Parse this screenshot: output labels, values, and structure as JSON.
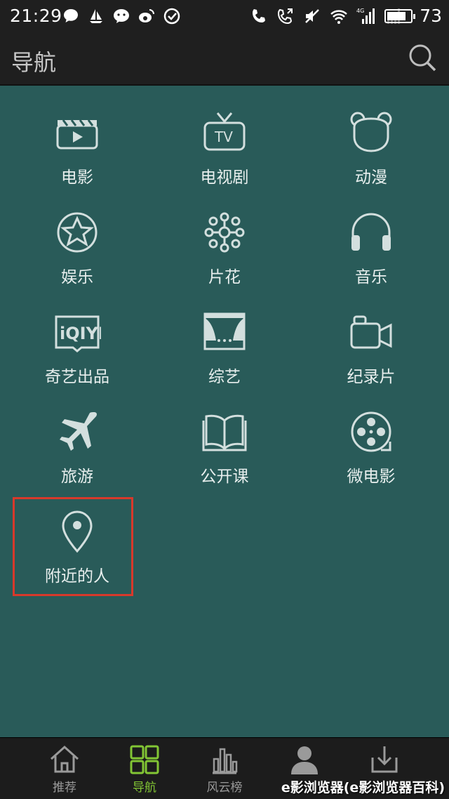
{
  "status_bar": {
    "time": "21:29",
    "battery": "73",
    "battery_level_percent": 73,
    "left_icons": [
      "chat-icon",
      "sailing-icon",
      "wechat-icon",
      "weibo-icon",
      "check-circle-icon"
    ],
    "right_icons": [
      "phone-icon",
      "call-forward-icon",
      "mute-icon",
      "wifi-icon",
      "signal-4g-icon",
      "signal-empty-icon"
    ]
  },
  "header": {
    "title": "导航",
    "search_icon": "search-icon"
  },
  "nav_items": [
    {
      "label": "电影",
      "icon": "movie-clapper-icon"
    },
    {
      "label": "电视剧",
      "icon": "tv-icon"
    },
    {
      "label": "动漫",
      "icon": "bear-face-icon"
    },
    {
      "label": "娱乐",
      "icon": "star-circle-icon"
    },
    {
      "label": "片花",
      "icon": "flower-icon"
    },
    {
      "label": "音乐",
      "icon": "headphones-icon"
    },
    {
      "label": "奇艺出品",
      "icon": "iqiyi-logo-icon"
    },
    {
      "label": "综艺",
      "icon": "stage-curtain-icon"
    },
    {
      "label": "纪录片",
      "icon": "camera-icon"
    },
    {
      "label": "旅游",
      "icon": "airplane-icon"
    },
    {
      "label": "公开课",
      "icon": "open-book-icon"
    },
    {
      "label": "微电影",
      "icon": "film-reel-icon"
    },
    {
      "label": "附近的人",
      "icon": "location-pin-icon"
    }
  ],
  "tabs": [
    {
      "label": "推荐",
      "icon": "home-icon",
      "active": false
    },
    {
      "label": "导航",
      "icon": "grid-icon",
      "active": true
    },
    {
      "label": "风云榜",
      "icon": "bar-chart-icon",
      "active": false
    },
    {
      "label": "",
      "icon": "user-icon",
      "active": false
    },
    {
      "label": "",
      "icon": "download-icon",
      "active": false
    }
  ],
  "watermark": "e影浏览器(e影浏览器百科)",
  "colors": {
    "background": "#295b59",
    "bar": "#1f1f1f",
    "icon": "#d3dfde",
    "accent": "#82c534",
    "highlight": "#d8392b"
  }
}
